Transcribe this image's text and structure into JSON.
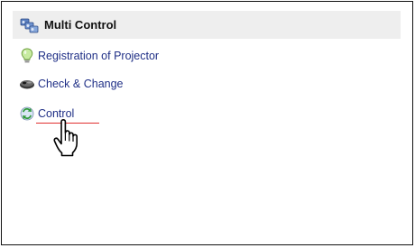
{
  "header": {
    "title": "Multi Control",
    "icon": "multi-projector-icon"
  },
  "menu": {
    "items": [
      {
        "label": "Registration of Projector",
        "icon": "lightbulb-icon"
      },
      {
        "label": "Check & Change",
        "icon": "projector-icon"
      },
      {
        "label": "Control",
        "icon": "control-arrows-icon"
      }
    ]
  },
  "cursor": {
    "icon": "hand-pointer-icon"
  },
  "colors": {
    "link": "#1f2f86",
    "header_bg": "#eeeeee",
    "underline": "#e03030"
  }
}
